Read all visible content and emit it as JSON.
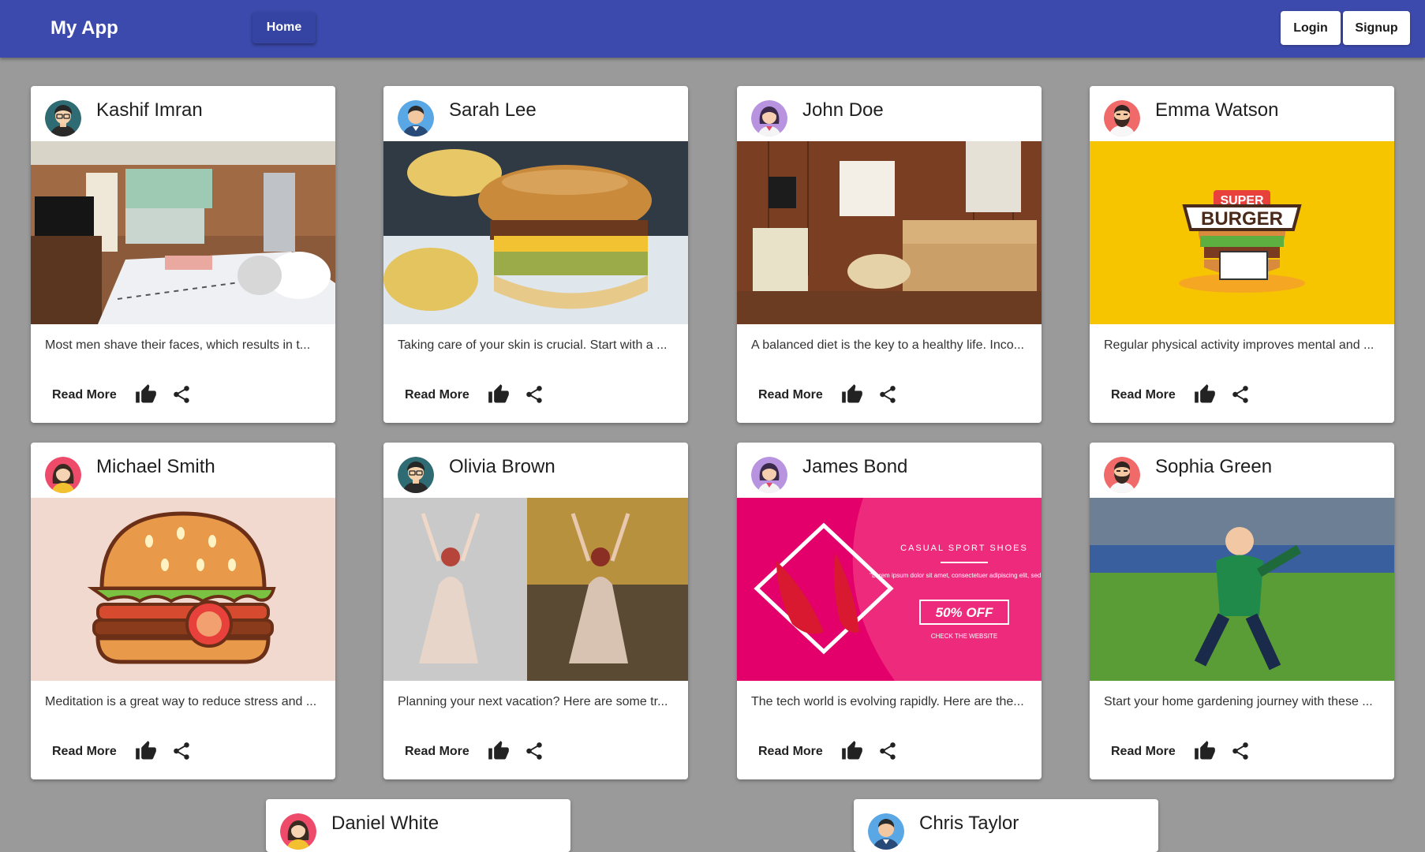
{
  "app": {
    "title": "My App",
    "nav_home": "Home",
    "login": "Login",
    "signup": "Signup"
  },
  "colors": {
    "appbar": "#3c4aad",
    "background": "#9a9a9a",
    "card": "#ffffff"
  },
  "cards": [
    {
      "name": "Kashif Imran",
      "desc": "Most men shave their faces, which results in t...",
      "read_more": "Read More",
      "avatar": "boy-glasses-avatar",
      "image": "bedroom-kitchen-photo"
    },
    {
      "name": "Sarah Lee",
      "desc": "Taking care of your skin is crucial. Start with a ...",
      "read_more": "Read More",
      "avatar": "man-blue-avatar",
      "image": "burger-chips-photo"
    },
    {
      "name": "John Doe",
      "desc": "A balanced diet is the key to a healthy life. Inco...",
      "read_more": "Read More",
      "avatar": "woman-purple-avatar",
      "image": "wooden-living-room-photo"
    },
    {
      "name": "Emma Watson",
      "desc": "Regular physical activity improves mental and ...",
      "read_more": "Read More",
      "avatar": "bearded-man-avatar",
      "image": "super-burger-logo"
    },
    {
      "name": "Michael Smith",
      "desc": "Meditation is a great way to reduce stress and ...",
      "read_more": "Read More",
      "avatar": "woman-yellow-avatar",
      "image": "burger-illustration"
    },
    {
      "name": "Olivia Brown",
      "desc": "Planning your next vacation? Here are some tr...",
      "read_more": "Read More",
      "avatar": "boy-glasses-avatar",
      "image": "dancer-before-after-photo"
    },
    {
      "name": "James Bond",
      "desc": "The tech world is evolving rapidly. Here are the...",
      "read_more": "Read More",
      "avatar": "woman-purple-avatar",
      "image": "sport-shoes-ad"
    },
    {
      "name": "Sophia Green",
      "desc": "Start your home gardening journey with these ...",
      "read_more": "Read More",
      "avatar": "bearded-man-avatar",
      "image": "kid-soccer-photo"
    },
    {
      "name": "Daniel White",
      "avatar": "woman-yellow-avatar"
    },
    {
      "name": "Chris Taylor",
      "avatar": "man-blue-avatar"
    }
  ],
  "ad": {
    "headline": "CASUAL SPORT SHOES",
    "body": "\"Lorem ipsum dolor sit amet, consectetuer adipiscing elit, sed diam\"",
    "offer": "50% OFF",
    "cta": "CHECK THE WEBSITE"
  },
  "logo": {
    "top": "SUPER",
    "main": "BURGER"
  }
}
